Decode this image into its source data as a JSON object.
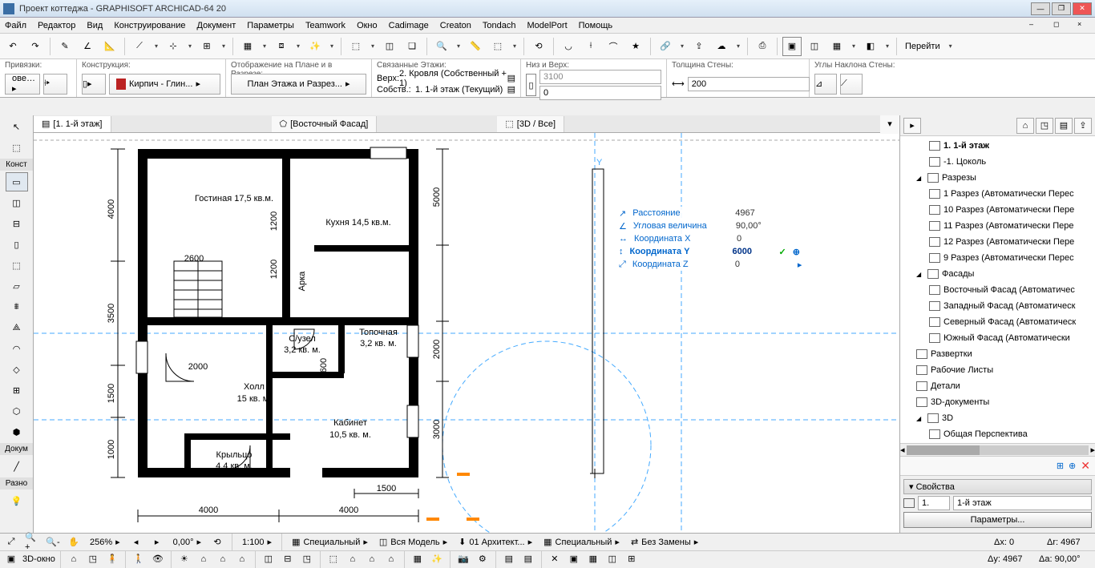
{
  "title": "Проект коттеджа - GRAPHISOFT ARCHICAD-64 20",
  "menu": [
    "Файл",
    "Редактор",
    "Вид",
    "Конструирование",
    "Документ",
    "Параметры",
    "Teamwork",
    "Окно",
    "Cadimage",
    "Creaton",
    "Tondach",
    "ModelPort",
    "Помощь"
  ],
  "propbar": {
    "snaps": "Привязки:",
    "construction": "Конструкция:",
    "material_btn": "Кирпич - Глин...",
    "display": "Отображение на Плане и в Разрезе:",
    "display_btn": "План Этажа и Разрез...",
    "linked": "Связанные Этажи:",
    "top": "Верх:",
    "top_val": "2. Кровля (Собственный + 1)",
    "own": "Собств.:",
    "own_val": "1. 1-й этаж (Текущий)",
    "bottom": "Низ и Верх:",
    "bottom_v1": "3100",
    "bottom_v2": "0",
    "thickness": "Толщина Стены:",
    "thickness_v": "200",
    "angles": "Углы Наклона Стены:"
  },
  "tabs": [
    "[1. 1-й этаж]",
    "[Восточный Фасад]",
    "[3D / Все]"
  ],
  "toolbox": {
    "section_design": "Конст",
    "section_doc": "Докум",
    "section_misc": "Разно"
  },
  "tracker": {
    "distance_l": "Расстояние",
    "distance_v": "4967",
    "angle_l": "Угловая величина",
    "angle_v": "90,00°",
    "x_l": "Координата X",
    "x_v": "0",
    "y_l": "Координата Y",
    "y_v": "6000",
    "z_l": "Координата Z",
    "z_v": "0"
  },
  "navigator": {
    "items": [
      {
        "label": "1. 1-й этаж",
        "bold": true,
        "indent": 2
      },
      {
        "label": "-1. Цоколь",
        "indent": 2
      },
      {
        "label": "Разрезы",
        "indent": 1,
        "tri": true
      },
      {
        "label": "1 Разрез (Автоматически Перес",
        "indent": 2
      },
      {
        "label": "10 Разрез (Автоматически Пере",
        "indent": 2
      },
      {
        "label": "11 Разрез (Автоматически Пере",
        "indent": 2
      },
      {
        "label": "12 Разрез (Автоматически Пере",
        "indent": 2
      },
      {
        "label": "9 Разрез (Автоматически Перес",
        "indent": 2
      },
      {
        "label": "Фасады",
        "indent": 1,
        "tri": true
      },
      {
        "label": "Восточный Фасад (Автоматичес",
        "indent": 2
      },
      {
        "label": "Западный Фасад (Автоматическ",
        "indent": 2
      },
      {
        "label": "Северный Фасад (Автоматическ",
        "indent": 2
      },
      {
        "label": "Южный Фасад (Автоматически",
        "indent": 2
      },
      {
        "label": "Развертки",
        "indent": 1
      },
      {
        "label": "Рабочие Листы",
        "indent": 1
      },
      {
        "label": "Детали",
        "indent": 1
      },
      {
        "label": "3D-документы",
        "indent": 1
      },
      {
        "label": "3D",
        "indent": 1,
        "tri": true
      },
      {
        "label": "Общая Перспектива",
        "indent": 2
      }
    ],
    "props_header": "Свойства",
    "props_num": "1.",
    "props_name": "1-й этаж",
    "params_btn": "Параметры..."
  },
  "statusbar": {
    "zoom": "256%",
    "angle": "0,00°",
    "scale": "1:100",
    "opt1": "Специальный",
    "opt2": "Вся Модель",
    "opt3": "01 Архитект...",
    "opt4": "Специальный",
    "opt5": "Без Замены",
    "view3d": "3D-окно",
    "dx": "Δx: 0",
    "dy": "Δy: 4967",
    "dr": "Δr: 4967",
    "da": "Δa: 90,00°"
  },
  "plan": {
    "rooms": {
      "living": "Гостиная 17,5 кв.м.",
      "kitchen": "Кухня 14,5 кв.м.",
      "arch": "Арка",
      "bath_l1": "С/узел",
      "bath_l2": "3,2 кв. м.",
      "boiler_l1": "Топочная",
      "boiler_l2": "3,2 кв. м.",
      "hall_l1": "Холл",
      "hall_l2": "15 кв. м.",
      "office_l1": "Кабинет",
      "office_l2": "10,5 кв. м.",
      "porch_l1": "Крыльцо",
      "porch_l2": "4,4 кв. м."
    },
    "dims": {
      "w_left": "4000",
      "w_right": "4000",
      "h_left_1": "4000",
      "h_left_2": "3500",
      "h_left_3": "1500",
      "h_left_4": "1000",
      "d2600": "2600",
      "d1200a": "1200",
      "d1200b": "1200",
      "d600": "600",
      "d2000": "2000",
      "d1500": "1500",
      "d5000": "5000",
      "d2000r": "2000",
      "d3000": "3000"
    }
  },
  "goto": "Перейти"
}
